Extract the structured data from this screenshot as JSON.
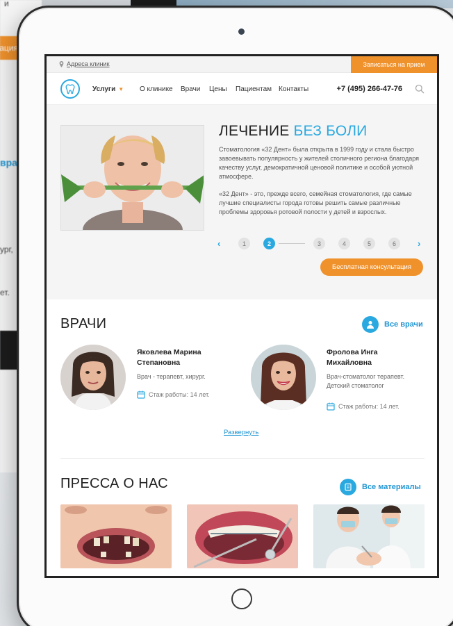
{
  "background": {
    "fragments": [
      "и",
      "ация",
      "вра",
      "ург,",
      "ет."
    ]
  },
  "topbar": {
    "address_link": "Адреса клиник",
    "signup_button": "Записаться на прием"
  },
  "nav": {
    "items": [
      "Услуги",
      "О клинике",
      "Врачи",
      "Цены",
      "Пациентам",
      "Контакты"
    ],
    "phone": "+7 (495) 266-47-76"
  },
  "hero": {
    "title_part1": "ЛЕЧЕНИЕ",
    "title_part2": "БЕЗ БОЛИ",
    "paragraph1": "Стоматология «32 Дент» была открыта в 1999 году и стала быстро завоевывать популярность у жителей столичного региона благодаря качеству услуг, демократичной ценовой политике и особой уютной атмосфере.",
    "paragraph2": "«32 Дент» - это, прежде всего, семейная стоматология, где самые лучшие специалисты города готовы решить самые различные проблемы здоровья ротовой полости у детей и взрослых.",
    "slider_pages": [
      "1",
      "2",
      "3",
      "4",
      "5",
      "6"
    ],
    "active_page": "2",
    "consult_button": "Бесплатная консультация"
  },
  "doctors": {
    "title": "ВРАЧИ",
    "all_link": "Все врачи",
    "list": [
      {
        "name": "Яковлева Марина Степановна",
        "role": "Врач - терапевт, хирург.",
        "experience": "Стаж работы: 14 лет."
      },
      {
        "name": "Фролова Инга Михайловна",
        "role": "Врач-стоматолог терапевт. Детский стоматолог",
        "experience": "Стаж работы: 14 лет."
      }
    ],
    "expand_link": "Развернуть"
  },
  "press": {
    "title": "ПРЕССА О НАС",
    "all_link": "Все материалы"
  },
  "colors": {
    "accent_orange": "#f0922c",
    "accent_blue": "#2aa9e0"
  }
}
